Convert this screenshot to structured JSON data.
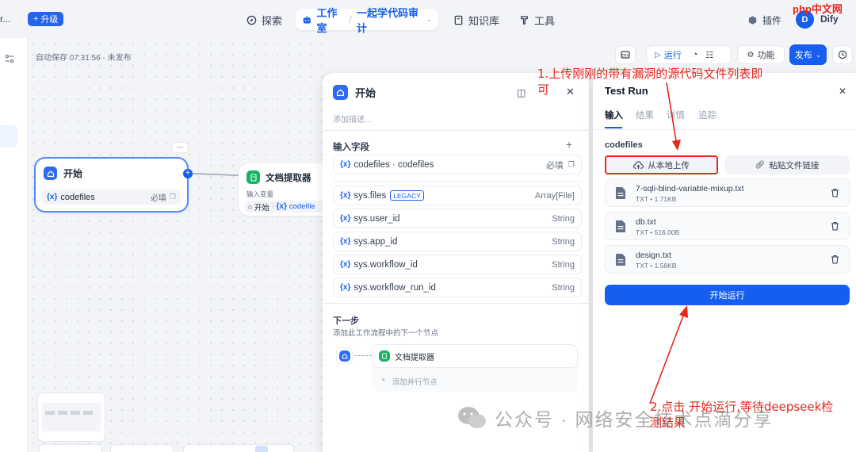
{
  "topnav": {
    "left_cut": "r...",
    "upgrade_label": "升级",
    "explore_label": "探索",
    "studio_label": "工作室",
    "app_name": "一起学代码审计",
    "knowledge_label": "知识库",
    "tools_label": "工具",
    "plugins_label": "插件",
    "avatar_letter": "D",
    "user_name": "Dify"
  },
  "toolbar": {
    "autosave": "自动保存 07:31:56 · 未发布",
    "run_label": "运行",
    "features_label": "功能",
    "publish_label": "发布"
  },
  "canvas": {
    "start_node": {
      "title": "开始",
      "var_prefix": "{x}",
      "var_name": "codefiles",
      "required": "必填",
      "more": "···"
    },
    "extractor_node": {
      "title": "文档提取器",
      "input_label": "输入变量",
      "source": "开始",
      "slash": "/",
      "var_prefix": "{x}",
      "var_name": "codefile"
    }
  },
  "start_panel": {
    "title": "开始",
    "description_placeholder": "添加描述...",
    "input_fields_label": "输入字段",
    "fields": [
      {
        "prefix": "{x}",
        "name": "codefiles · codefiles",
        "type": "必填",
        "badge": ""
      },
      {
        "prefix": "{x}",
        "name": "sys.files",
        "type": "Array[File]",
        "badge": "LEGACY"
      },
      {
        "prefix": "{x}",
        "name": "sys.user_id",
        "type": "String",
        "badge": ""
      },
      {
        "prefix": "{x}",
        "name": "sys.app_id",
        "type": "String",
        "badge": ""
      },
      {
        "prefix": "{x}",
        "name": "sys.workflow_id",
        "type": "String",
        "badge": ""
      },
      {
        "prefix": "{x}",
        "name": "sys.workflow_run_id",
        "type": "String",
        "badge": ""
      }
    ],
    "next_step_label": "下一步",
    "next_step_desc": "添加此工作流程中的下一个节点",
    "next_node": "文档提取器",
    "add_parallel": "添加并行节点"
  },
  "test_run": {
    "title": "Test Run",
    "tabs": [
      "输入",
      "结果",
      "详情",
      "追踪"
    ],
    "var_label": "codefiles",
    "upload_local": "从本地上传",
    "paste_link": "粘贴文件链接",
    "files": [
      {
        "name": "7-sqli-blind-variable-mixup.txt",
        "meta": "TXT • 1.71KB"
      },
      {
        "name": "db.txt",
        "meta": "TXT • 516.00B"
      },
      {
        "name": "design.txt",
        "meta": "TXT • 1.58KB"
      }
    ],
    "start_run": "开始运行"
  },
  "annotations": {
    "note1_line1": "1.上传刚刚的带有漏洞的源代码文件列表即",
    "note1_line2": "可",
    "note2_line1": "2.点击 开始运行,等待deepseek检",
    "note2_line2": "测结果"
  },
  "watermark": {
    "text": "公众号 · 网络安全技术点滴分享",
    "logo_text": "php中文网"
  },
  "colors": {
    "accent": "#155eef",
    "annotation": "#e8261d",
    "start_icon": "#2e6bf0",
    "extractor_icon": "#16b364"
  }
}
